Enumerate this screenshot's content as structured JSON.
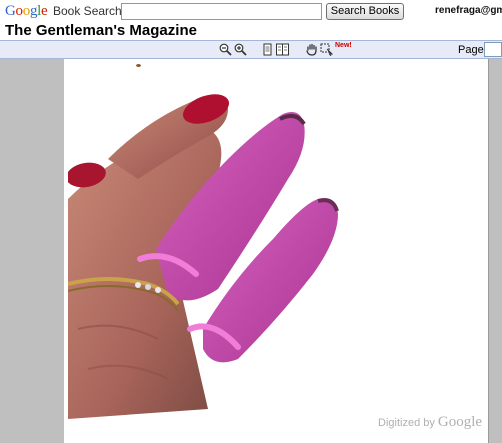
{
  "header": {
    "logo": {
      "g1": "G",
      "o1": "o",
      "o2": "o",
      "g2": "g",
      "l": "l",
      "e": "e"
    },
    "product_label": "Book Search",
    "search_value": "",
    "search_button_label": "Search Books",
    "user_email": "renefraga@gmail.com",
    "book_title": "The Gentleman's Magazine"
  },
  "toolbar": {
    "icons": [
      "zoom-out-icon",
      "zoom-in-icon",
      "single-page-icon",
      "two-page-icon",
      "pan-hand-icon",
      "select-tool-icon"
    ],
    "new_badge": "New!",
    "page_label": "Page",
    "page_value": ""
  },
  "viewer": {
    "footer_prefix": "Digitized by",
    "footer_brand": "Google"
  },
  "colors": {
    "toolbar_bg": "#e6ebf7",
    "viewer_bg": "#bfbfbf",
    "link_blue": "#3366cc",
    "glove_pink": "#d04fb5",
    "nail_red": "#b01030"
  }
}
